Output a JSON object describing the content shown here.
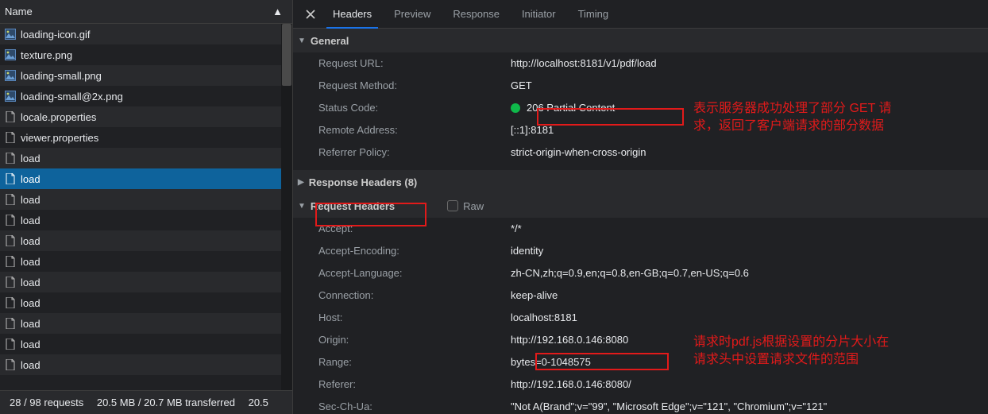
{
  "left": {
    "column_header": "Name",
    "files": [
      {
        "name": "loading-icon.gif",
        "icon": "img"
      },
      {
        "name": "texture.png",
        "icon": "img"
      },
      {
        "name": "loading-small.png",
        "icon": "img"
      },
      {
        "name": "loading-small@2x.png",
        "icon": "img"
      },
      {
        "name": "locale.properties",
        "icon": "doc"
      },
      {
        "name": "viewer.properties",
        "icon": "doc"
      },
      {
        "name": "load",
        "icon": "doc"
      },
      {
        "name": "load",
        "icon": "doc",
        "selected": true
      },
      {
        "name": "load",
        "icon": "doc"
      },
      {
        "name": "load",
        "icon": "doc"
      },
      {
        "name": "load",
        "icon": "doc"
      },
      {
        "name": "load",
        "icon": "doc"
      },
      {
        "name": "load",
        "icon": "doc"
      },
      {
        "name": "load",
        "icon": "doc"
      },
      {
        "name": "load",
        "icon": "doc"
      },
      {
        "name": "load",
        "icon": "doc"
      },
      {
        "name": "load",
        "icon": "doc"
      }
    ],
    "status": "28 / 98 requests  20.5 MB / 20.7 MB transferred  20.5 "
  },
  "tabs": {
    "items": [
      "Headers",
      "Preview",
      "Response",
      "Initiator",
      "Timing"
    ],
    "active": 0
  },
  "general": {
    "title": "General",
    "rows": {
      "request_url": {
        "k": "Request URL:",
        "v": "http://localhost:8181/v1/pdf/load"
      },
      "request_method": {
        "k": "Request Method:",
        "v": "GET"
      },
      "status_code": {
        "k": "Status Code:",
        "v": "206 Partial Content"
      },
      "remote_addr": {
        "k": "Remote Address:",
        "v": "[::1]:8181"
      },
      "referrer_pol": {
        "k": "Referrer Policy:",
        "v": "strict-origin-when-cross-origin"
      }
    }
  },
  "response_headers": {
    "title": "Response Headers (8)"
  },
  "request_headers": {
    "title": "Request Headers",
    "raw_label": "Raw",
    "rows": {
      "accept": {
        "k": "Accept:",
        "v": "*/*"
      },
      "accept_encoding": {
        "k": "Accept-Encoding:",
        "v": "identity"
      },
      "accept_language": {
        "k": "Accept-Language:",
        "v": "zh-CN,zh;q=0.9,en;q=0.8,en-GB;q=0.7,en-US;q=0.6"
      },
      "connection": {
        "k": "Connection:",
        "v": "keep-alive"
      },
      "host": {
        "k": "Host:",
        "v": "localhost:8181"
      },
      "origin": {
        "k": "Origin:",
        "v": "http://192.168.0.146:8080"
      },
      "range": {
        "k": "Range:",
        "v": "bytes=0-1048575"
      },
      "referer": {
        "k": "Referer:",
        "v": "http://192.168.0.146:8080/"
      },
      "sec_ch_ua": {
        "k": "Sec-Ch-Ua:",
        "v": "\"Not A(Brand\";v=\"99\", \"Microsoft Edge\";v=\"121\", \"Chromium\";v=\"121\""
      }
    }
  },
  "annotations": {
    "status_line1": "表示服务器成功处理了部分 GET 请",
    "status_line2": "求，返回了客户端请求的部分数据",
    "range_line1": "请求时pdf.js根据设置的分片大小在",
    "range_line2": "请求头中设置请求文件的范围"
  }
}
